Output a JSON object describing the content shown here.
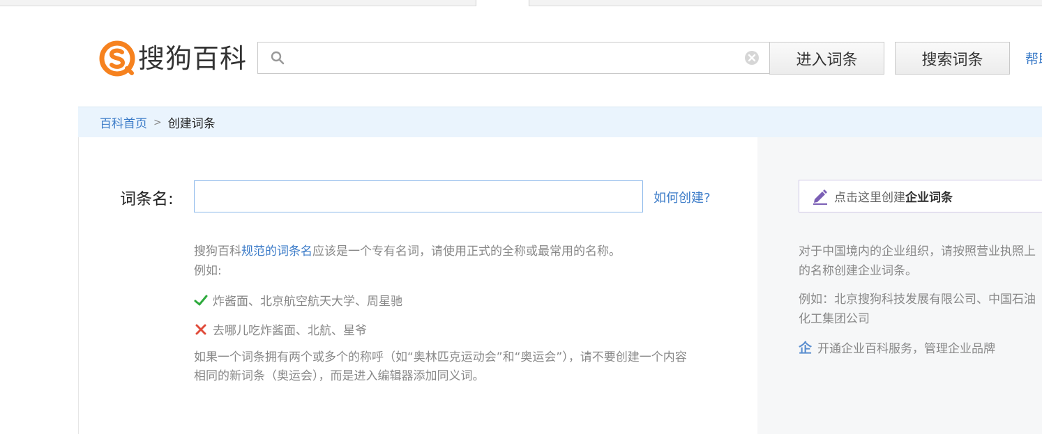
{
  "header": {
    "logo_text": "搜狗百科",
    "search": {
      "value": "",
      "placeholder": ""
    },
    "enter_entry_label": "进入词条",
    "search_entry_label": "搜索词条",
    "help_label": "帮助"
  },
  "breadcrumb": {
    "home": "百科首页",
    "current": "创建词条"
  },
  "form": {
    "name_label": "词条名:",
    "name_value": "",
    "how_to_link": "如何创建?",
    "tip_prefix": "搜狗百科",
    "tip_link": "规范的词条名",
    "tip_suffix": "应该是一个专有名词，请使用正式的全称或最常用的名称。",
    "example_label": "例如:",
    "good_example": "炸酱面、北京航空航天大学、周星驰",
    "bad_example": "去哪儿吃炸酱面、北航、星爷",
    "note_line1": "如果一个词条拥有两个或多个的称呼（如“奥林匹克运动会”和“奥运会”），请不要创建一个内容",
    "note_line2": "相同的新词条（奥运会），而是进入编辑器添加同义词。"
  },
  "sidebar": {
    "create_prefix": "点击这里创建",
    "create_bold": "企业词条",
    "info_line1": "对于中国境内的企业组织，请按照营业执照上",
    "info_line2": "的名称创建企业词条。",
    "example_line1": "例如：北京搜狗科技发展有限公司、中国石油",
    "example_line2": "化工集团公司",
    "service_icon_char": "企",
    "service_text": "开通企业百科服务，管理企业品牌"
  },
  "colors": {
    "link": "#3b7bc8",
    "breadcrumb_bg": "#eaf4fd",
    "logo_orange": "#f6821f",
    "good": "#2eaa3d",
    "bad": "#e04b3a",
    "enterprise": "#7b5fb5"
  },
  "icons": {
    "search": "search-icon",
    "clear": "clear-icon",
    "check": "check-icon",
    "cross": "cross-icon",
    "pencil": "pencil-icon",
    "enterprise": "enterprise-icon"
  }
}
